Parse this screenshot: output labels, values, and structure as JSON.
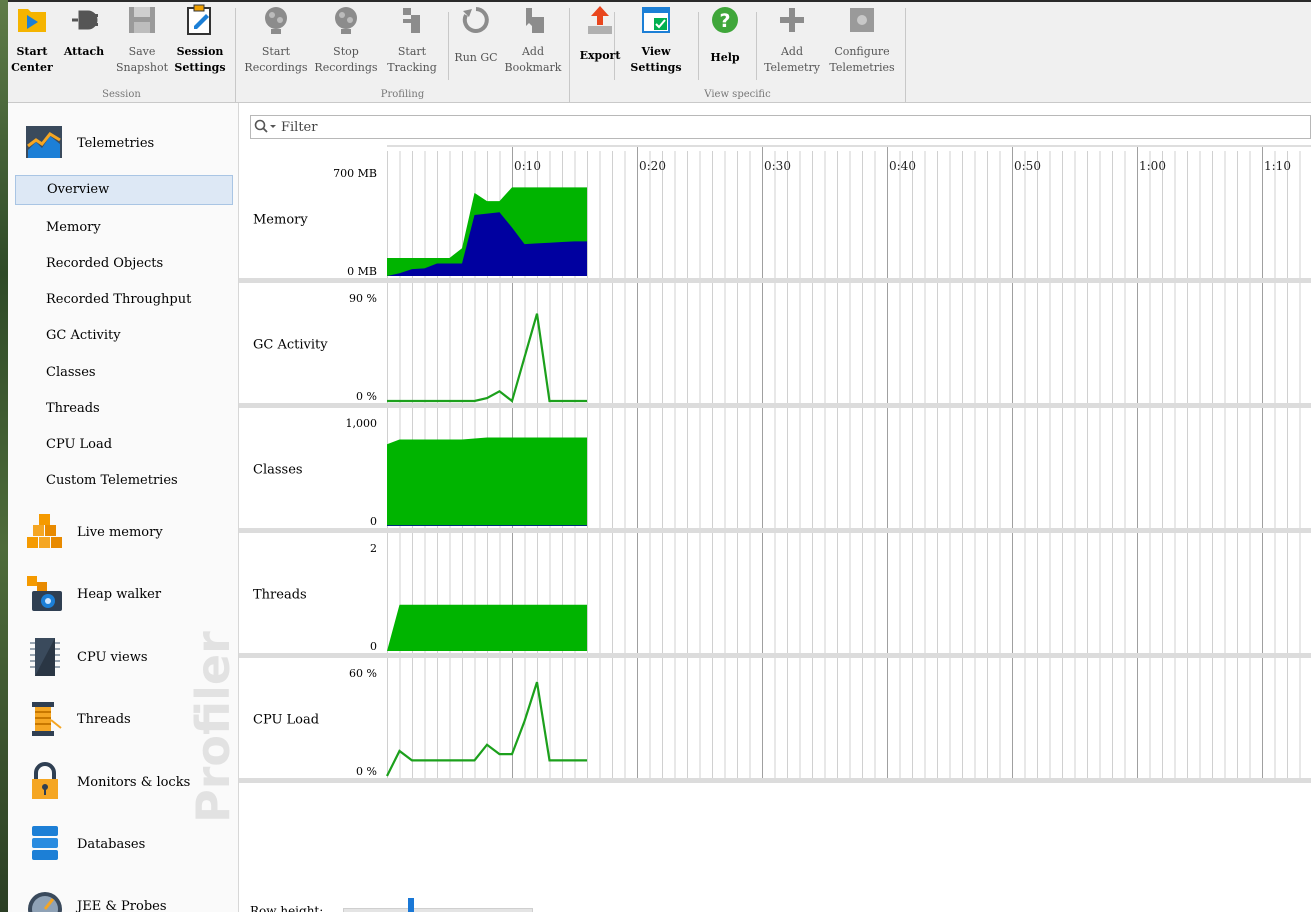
{
  "toolbar": {
    "groups": [
      {
        "label": "Session"
      },
      {
        "label": "Profiling"
      },
      {
        "label": "View specific"
      }
    ],
    "buttons": [
      {
        "id": "start-center",
        "label": "Start\nCenter",
        "icon": "start-center-icon",
        "enabled": true
      },
      {
        "id": "attach",
        "label": "Attach",
        "icon": "attach-plug-icon",
        "enabled": true
      },
      {
        "id": "save-snapshot",
        "label": "Save\nSnapshot",
        "icon": "save-disk-icon",
        "enabled": false
      },
      {
        "id": "session-settings",
        "label": "Session\nSettings",
        "icon": "session-settings-icon",
        "enabled": true
      },
      {
        "id": "start-recordings",
        "label": "Start\nRecordings",
        "icon": "start-recordings-icon",
        "enabled": false
      },
      {
        "id": "stop-recordings",
        "label": "Stop\nRecordings",
        "icon": "stop-recordings-icon",
        "enabled": false
      },
      {
        "id": "start-tracking",
        "label": "Start\nTracking",
        "icon": "start-tracking-icon",
        "enabled": false
      },
      {
        "id": "run-gc",
        "label": "Run GC",
        "icon": "run-gc-icon",
        "enabled": false
      },
      {
        "id": "add-bookmark",
        "label": "Add\nBookmark",
        "icon": "add-bookmark-icon",
        "enabled": false
      },
      {
        "id": "export",
        "label": "Export",
        "icon": "export-icon",
        "enabled": true
      },
      {
        "id": "view-settings",
        "label": "View\nSettings",
        "icon": "view-settings-icon",
        "enabled": true
      },
      {
        "id": "help",
        "label": "Help",
        "icon": "help-icon",
        "enabled": true
      },
      {
        "id": "add-telemetry",
        "label": "Add\nTelemetry",
        "icon": "add-plus-icon",
        "enabled": false
      },
      {
        "id": "configure-telemetries",
        "label": "Configure\nTelemetries",
        "icon": "configure-icon",
        "enabled": false
      }
    ]
  },
  "sidebar": {
    "watermark": "Profiler",
    "telemetries": {
      "label": "Telemetries",
      "icon": "telemetries-chart-icon"
    },
    "subitems": [
      {
        "label": "Overview",
        "selected": true
      },
      {
        "label": "Memory"
      },
      {
        "label": "Recorded Objects"
      },
      {
        "label": "Recorded Throughput"
      },
      {
        "label": "GC Activity"
      },
      {
        "label": "Classes"
      },
      {
        "label": "Threads"
      },
      {
        "label": "CPU Load"
      },
      {
        "label": "Custom Telemetries"
      }
    ],
    "sections": [
      {
        "label": "Live memory",
        "icon": "live-memory-cubes-icon"
      },
      {
        "label": "Heap walker",
        "icon": "heap-walker-camera-icon"
      },
      {
        "label": "CPU views",
        "icon": "cpu-chip-icon"
      },
      {
        "label": "Threads",
        "icon": "threads-spool-icon"
      },
      {
        "label": "Monitors & locks",
        "icon": "padlock-icon"
      },
      {
        "label": "Databases",
        "icon": "database-icon"
      },
      {
        "label": "JEE & Probes",
        "icon": "gauge-icon"
      }
    ]
  },
  "main": {
    "filter_placeholder": "Filter",
    "row_height_label": "Row height:",
    "row_height_value": 0.36
  },
  "colors": {
    "green": "#00b400",
    "blue": "#0000a0",
    "line_green": "#1ca01c",
    "grid": "#d0d0d0",
    "major": "#a0a0a0",
    "row_sep": "#dcdcdc"
  },
  "chart_data": {
    "type": "area",
    "x_unit": "seconds",
    "time_ticks": [
      "0:10",
      "0:20",
      "0:30",
      "0:40",
      "0:50",
      "1:00",
      "1:10"
    ],
    "x": [
      0,
      1,
      2,
      3,
      4,
      5,
      6,
      7,
      8,
      9,
      10,
      11,
      12,
      13,
      14,
      15,
      16
    ],
    "rows": [
      {
        "label": "Memory",
        "ymin_label": "0 MB",
        "ymax_label": "700 MB",
        "ymax": 700,
        "kind": "stacked",
        "series": [
          {
            "values": [
              130,
              130,
              130,
              130,
              130,
              130,
              200,
              600,
              540,
              540,
              640,
              640,
              640,
              640,
              640,
              640,
              640
            ]
          },
          {
            "values": [
              0,
              20,
              50,
              55,
              90,
              90,
              90,
              440,
              450,
              460,
              350,
              230,
              235,
              240,
              245,
              250,
              250
            ]
          }
        ]
      },
      {
        "label": "GC Activity",
        "ymin_label": "0 %",
        "ymax_label": "90 %",
        "ymax": 100,
        "kind": "line",
        "series": [
          {
            "values": [
              0,
              0,
              0,
              0,
              0,
              0,
              0,
              0,
              3,
              10,
              0,
              45,
              90,
              0,
              0,
              0,
              0
            ]
          }
        ]
      },
      {
        "label": "Classes",
        "ymin_label": "0",
        "ymax_label": "1,000",
        "ymax": 1020,
        "kind": "stacked",
        "series": [
          {
            "values": [
              860,
              910,
              910,
              910,
              910,
              910,
              910,
              920,
              930,
              930,
              930,
              930,
              930,
              930,
              930,
              930,
              930
            ]
          },
          {
            "values": [
              8,
              8,
              8,
              8,
              8,
              8,
              8,
              8,
              8,
              8,
              8,
              8,
              8,
              8,
              8,
              8,
              8
            ]
          }
        ]
      },
      {
        "label": "Threads",
        "ymin_label": "0",
        "ymax_label": "2",
        "ymax": 2.1,
        "kind": "area",
        "series": [
          {
            "values": [
              0,
              1,
              1,
              1,
              1,
              1,
              1,
              1,
              1,
              1,
              1,
              1,
              1,
              1,
              1,
              1,
              1
            ]
          }
        ]
      },
      {
        "label": "CPU Load",
        "ymin_label": "0 %",
        "ymax_label": "60 %",
        "ymax": 62,
        "kind": "line",
        "series": [
          {
            "values": [
              0,
              16,
              10,
              10,
              10,
              10,
              10,
              10,
              20,
              14,
              14,
              35,
              60,
              10,
              10,
              10,
              10
            ]
          }
        ]
      }
    ]
  }
}
